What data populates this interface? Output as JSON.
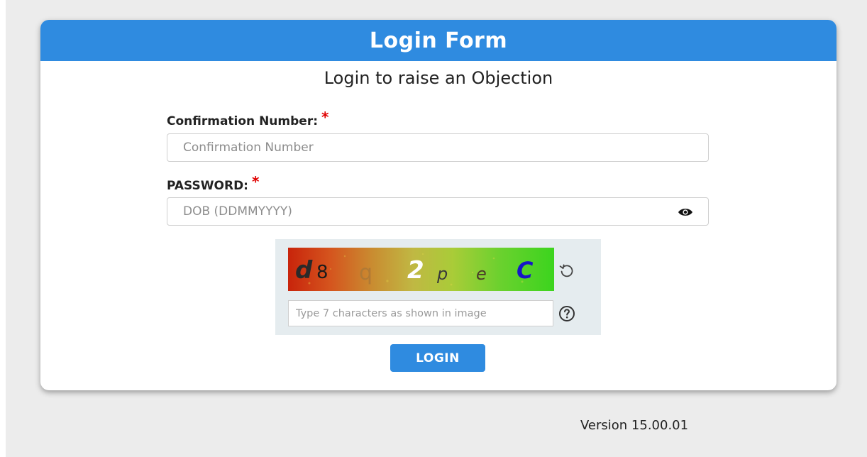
{
  "form": {
    "title": "Login Form",
    "subtitle": "Login to raise an Objection",
    "confirmation": {
      "label": "Confirmation Number:",
      "required_mark": "*",
      "placeholder": "Confirmation Number",
      "value": ""
    },
    "password": {
      "label": "PASSWORD:",
      "required_mark": "*",
      "placeholder": "DOB (DDMMYYYY)",
      "value": "",
      "toggle_icon": "eye-icon"
    },
    "captcha": {
      "characters": [
        "d",
        "8",
        "q",
        "2",
        "p",
        "e",
        "C"
      ],
      "refresh_icon": "refresh-icon",
      "input_placeholder": "Type 7 characters as shown in image",
      "input_value": "",
      "help_icon": "help-icon"
    },
    "login_label": "LOGIN"
  },
  "footer": {
    "version": "Version 15.00.01"
  },
  "colors": {
    "accent": "#2f8be0",
    "required": "#e00000",
    "page_background": "#ececec",
    "captcha_panel": "#e5ecef"
  }
}
